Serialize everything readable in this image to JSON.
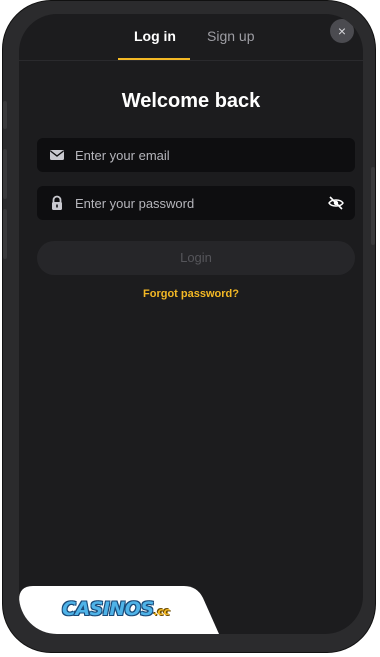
{
  "tabs": {
    "login": "Log in",
    "signup": "Sign up"
  },
  "close_glyph": "×",
  "title": "Welcome back",
  "email": {
    "placeholder": "Enter your email",
    "value": "",
    "icon": "envelope-icon"
  },
  "password": {
    "placeholder": "Enter your password",
    "value": "",
    "icon": "lock-icon",
    "toggle_icon": "eye-slash-icon"
  },
  "login_button": "Login",
  "forgot_link": "Forgot password?",
  "watermark": {
    "logo_text": "CASINOS",
    "logo_suffix": ".cc"
  },
  "colors": {
    "accent": "#f3b825",
    "background": "#1c1c1e",
    "field": "#0e0e10",
    "button_disabled": "#262629"
  }
}
